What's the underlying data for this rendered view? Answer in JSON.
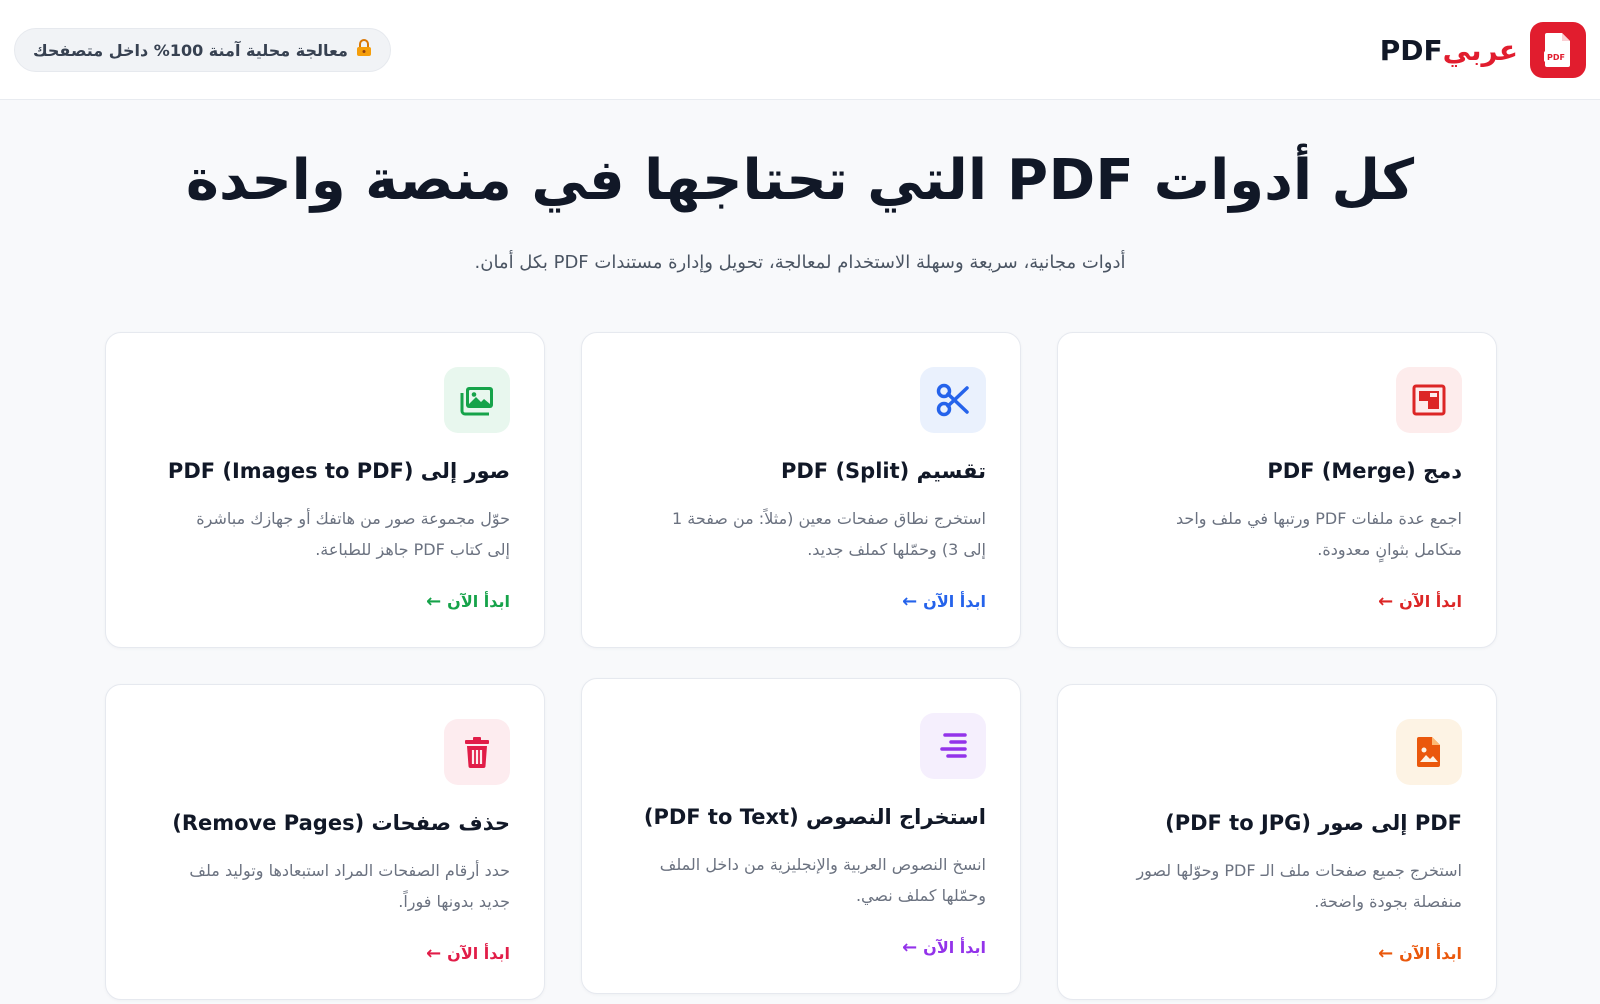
{
  "header": {
    "logo_pdf": "PDF",
    "logo_arabic": "عربي",
    "logo_icon": "pdf-file-icon",
    "security_badge": "معالجة محلية آمنة 100% داخل متصفحك",
    "security_icon": "lock-icon"
  },
  "hero": {
    "title": "كل أدوات PDF التي تحتاجها في منصة واحدة",
    "subtitle": "أدوات مجانية، سريعة وسهلة الاستخدام لمعالجة، تحويل وإدارة مستندات PDF بكل أمان."
  },
  "cta_label": "ابدأ الآن",
  "tools": [
    {
      "title": "دمج PDF (Merge)",
      "desc": "اجمع عدة ملفات PDF ورتبها في ملف واحد متكامل بثوانٍ معدودة.",
      "icon": "merge-icon",
      "color": "#dc2626",
      "bg": "#fdecec"
    },
    {
      "title": "تقسيم PDF (Split)",
      "desc": "استخرج نطاق صفحات معين (مثلاً: من صفحة 1 إلى 3) وحمّلها كملف جديد.",
      "icon": "scissors-icon",
      "color": "#2563eb",
      "bg": "#eaf1fd"
    },
    {
      "title": "صور إلى PDF (Images to PDF)",
      "desc": "حوّل مجموعة صور من هاتفك أو جهازك مباشرة إلى كتاب PDF جاهز للطباعة.",
      "icon": "images-icon",
      "color": "#16a34a",
      "bg": "#e8f7ee"
    },
    {
      "title": "PDF إلى صور (PDF to JPG)",
      "desc": "استخرج جميع صفحات ملف الـ PDF وحوّلها لصور منفصلة بجودة واضحة.",
      "icon": "image-file-icon",
      "color": "#ea580c",
      "bg": "#fdf3e4"
    },
    {
      "title": "استخراج النصوص (PDF to Text)",
      "desc": "انسخ النصوص العربية والإنجليزية من داخل الملف وحمّلها كملف نصي.",
      "icon": "text-lines-icon",
      "color": "#9333ea",
      "bg": "#f5effd"
    },
    {
      "title": "حذف صفحات (Remove Pages)",
      "desc": "حدد أرقام الصفحات المراد استبعادها وتوليد ملف جديد بدونها فوراً.",
      "icon": "trash-icon",
      "color": "#e11d48",
      "bg": "#fdecef"
    }
  ]
}
